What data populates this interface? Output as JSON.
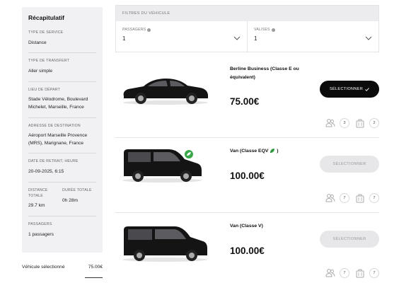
{
  "summary": {
    "title": "Récapitulatif",
    "service_type": {
      "label": "Type de service",
      "value": "Distance"
    },
    "transfer_type": {
      "label": "Type de transfert",
      "value": "Aller simple"
    },
    "departure": {
      "label": "Lieu de départ",
      "value": "Stade Vélodrome, Boulevard Michelet, Marseille, France"
    },
    "destination": {
      "label": "Adresse de destination",
      "value": "Aéroport Marseille Provence (MRS), Marignane, France"
    },
    "pickup": {
      "label": "Date de retrait, heure",
      "value": "20-09-2025, 6:15"
    },
    "distance": {
      "label": "Distance totale",
      "value": "29.7 km"
    },
    "duration": {
      "label": "Durée totale",
      "value": "0h 28m"
    },
    "passengers": {
      "label": "Passagers",
      "value": "1 passagers"
    }
  },
  "selected_vehicle": {
    "label": "Véhicule sélectionné",
    "value": "75.00€"
  },
  "filters": {
    "title": "Filtres du véhicule",
    "passengers": {
      "label": "Passagers",
      "value": "1"
    },
    "luggage": {
      "label": "Valises",
      "value": "1"
    }
  },
  "vehicles": [
    {
      "name": "Berline Business (Classe E ou équivalent)",
      "price": "75.00€",
      "button": "Sélectionner",
      "selected": true,
      "passengers": "3",
      "luggage": "2",
      "eco": false
    },
    {
      "name": "Van (Classe EQV",
      "name_suffix": ")",
      "price": "100.00€",
      "button": "Sélectionner",
      "selected": false,
      "passengers": "7",
      "luggage": "7",
      "eco": true
    },
    {
      "name": "Van (Classe V)",
      "price": "100.00€",
      "button": "Sélectionner",
      "selected": false,
      "passengers": "7",
      "luggage": "7",
      "eco": false
    }
  ],
  "colors": {
    "accent": "#0b0b0b",
    "sidebar_bg": "#f1f1f3",
    "disabled_btn": "#e7e7ea",
    "eco_green": "#3aa84a"
  },
  "icons": {
    "passenger": "people-icon",
    "luggage": "suitcase-icon",
    "check": "check-icon",
    "info": "info-icon",
    "chevron": "chevron-down-icon",
    "eco": "leaf-icon"
  }
}
